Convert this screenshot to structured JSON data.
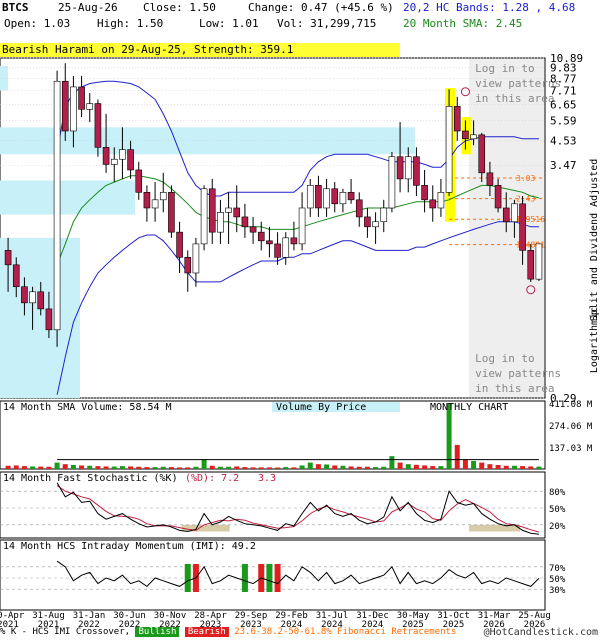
{
  "header": {
    "symbol": "BTCS",
    "date": "25-Aug-26",
    "close": "Close: 1.50",
    "change": "Change: 0.47 (+45.6 %)",
    "open": "Open: 1.03",
    "high": "High: 1.50",
    "low": "Low: 1.01",
    "vol": "Vol: 31,299,715",
    "bands": "20,2 HC Bands: 1.28 , 4.68",
    "sma": "20 Month SMA: 2.45"
  },
  "pattern_banner": "Bearish Harami on 29-Aug-25, Strength: 359.1",
  "login_text_1": [
    "Log in to",
    "view patterns",
    "in this area"
  ],
  "login_text_2": [
    "Log in to",
    "view patterns",
    "in this area"
  ],
  "right_axis_title": "Split and Dividend Adjusted",
  "log_label": "Logarithmic",
  "volume_label": "14 Month SMA Volume: 58.54 M",
  "vbp_label": "Volume By Price",
  "monthly_label": "MONTHLY CHART",
  "stoch_label": "14 Month Fast Stochastic (%K)",
  "stoch_d": "(%D): 7.2",
  "stoch_k": "3.3",
  "imi_label": "14 Month HCS Intraday Momentum (IMI): 49.2",
  "footer": {
    "prefix": "% K - HCS IMI Crossover,",
    "bullish": "Bullish",
    "bearish": "Bearish",
    "fib": "23.6-38.2-50-61.8% Fibonacci Retracements",
    "brand": "@HotCandlestick.com"
  },
  "colors": {
    "up": "#ffffff",
    "down": "#b0204a",
    "band": "#2020cc",
    "sma": "#1a8a1a",
    "vbp": "#c8f0f8",
    "fib": "#ff6a00",
    "highlight": "#ffff00",
    "grey": "#eeeeee"
  },
  "x_labels": [
    [
      "30-Apr",
      "2021"
    ],
    [
      "31-Aug",
      "2021"
    ],
    [
      "31-Jan",
      "2022"
    ],
    [
      "30-Jun",
      "2022"
    ],
    [
      "30-Nov",
      "2022"
    ],
    [
      "28-Apr",
      "2023"
    ],
    [
      "29-Sep",
      "2023"
    ],
    [
      "29-Feb",
      "2024"
    ],
    [
      "31-Jul",
      "2024"
    ],
    [
      "31-Dec",
      "2024"
    ],
    [
      "30-May",
      "2025"
    ],
    [
      "31-Oct",
      "2025"
    ],
    [
      "31-Mar",
      "2026"
    ],
    [
      "25-Aug",
      "2026"
    ]
  ],
  "chart_data": {
    "type": "line",
    "title": "BTCS Monthly Chart",
    "price_axis_scale": "log",
    "price_ticks": [
      10.89,
      9.83,
      8.77,
      7.71,
      6.65,
      5.59,
      4.53,
      3.47,
      0.29
    ],
    "fib_levels": [
      {
        "label": "3.03",
        "value": 3.03
      },
      {
        "label": "2.43",
        "value": 2.43
      },
      {
        "label": "1.9516",
        "value": 1.9516
      },
      {
        "label": "1.4881",
        "value": 1.4881
      }
    ],
    "candles": [
      [
        1.4,
        1.6,
        0.9,
        1.2
      ],
      [
        1.2,
        1.3,
        0.85,
        0.95
      ],
      [
        0.95,
        1.05,
        0.7,
        0.8
      ],
      [
        0.8,
        0.95,
        0.6,
        0.9
      ],
      [
        0.9,
        1.0,
        0.7,
        0.75
      ],
      [
        0.75,
        0.9,
        0.55,
        0.6
      ],
      [
        0.6,
        9.5,
        0.5,
        8.5
      ],
      [
        8.5,
        10.3,
        4.5,
        5.0
      ],
      [
        5.0,
        9.0,
        4.2,
        8.0
      ],
      [
        8.0,
        9.0,
        5.8,
        6.3
      ],
      [
        6.3,
        7.5,
        5.5,
        6.7
      ],
      [
        6.7,
        7.0,
        3.8,
        4.2
      ],
      [
        4.2,
        6.0,
        3.2,
        3.5
      ],
      [
        3.5,
        4.2,
        2.9,
        3.7
      ],
      [
        3.7,
        5.2,
        3.0,
        4.1
      ],
      [
        4.1,
        4.5,
        3.0,
        3.3
      ],
      [
        3.3,
        3.6,
        2.4,
        2.6
      ],
      [
        2.6,
        2.8,
        1.9,
        2.2
      ],
      [
        2.2,
        2.9,
        1.9,
        2.4
      ],
      [
        2.4,
        3.2,
        2.1,
        2.6
      ],
      [
        2.6,
        2.8,
        1.6,
        1.7
      ],
      [
        1.7,
        1.9,
        1.1,
        1.3
      ],
      [
        1.3,
        1.4,
        0.9,
        1.1
      ],
      [
        1.1,
        1.6,
        0.95,
        1.5
      ],
      [
        1.5,
        2.8,
        1.4,
        2.7
      ],
      [
        2.7,
        3.0,
        1.5,
        1.7
      ],
      [
        1.7,
        2.4,
        1.5,
        2.1
      ],
      [
        2.1,
        2.6,
        1.5,
        2.2
      ],
      [
        2.2,
        2.8,
        1.7,
        2.0
      ],
      [
        2.0,
        2.3,
        1.6,
        1.8
      ],
      [
        1.8,
        2.0,
        1.5,
        1.7
      ],
      [
        1.7,
        1.9,
        1.4,
        1.55
      ],
      [
        1.55,
        1.8,
        1.3,
        1.5
      ],
      [
        1.5,
        1.7,
        1.2,
        1.3
      ],
      [
        1.3,
        1.7,
        1.2,
        1.6
      ],
      [
        1.6,
        1.9,
        1.4,
        1.5
      ],
      [
        1.5,
        2.6,
        1.4,
        2.2
      ],
      [
        2.2,
        3.0,
        2.0,
        2.8
      ],
      [
        2.8,
        3.1,
        2.0,
        2.2
      ],
      [
        2.2,
        3.0,
        2.0,
        2.7
      ],
      [
        2.7,
        2.9,
        2.1,
        2.3
      ],
      [
        2.3,
        2.7,
        2.1,
        2.6
      ],
      [
        2.6,
        3.0,
        2.3,
        2.4
      ],
      [
        2.4,
        2.6,
        1.8,
        2.0
      ],
      [
        2.0,
        2.2,
        1.6,
        1.8
      ],
      [
        1.8,
        2.1,
        1.5,
        1.9
      ],
      [
        1.9,
        2.4,
        1.7,
        2.2
      ],
      [
        2.2,
        4.0,
        2.1,
        3.8
      ],
      [
        3.8,
        5.5,
        2.6,
        3.0
      ],
      [
        3.0,
        4.2,
        2.6,
        3.8
      ],
      [
        3.8,
        4.2,
        2.5,
        2.8
      ],
      [
        2.8,
        3.3,
        2.1,
        2.4
      ],
      [
        2.4,
        2.8,
        1.9,
        2.2
      ],
      [
        2.2,
        3.0,
        2.0,
        2.6
      ],
      [
        2.6,
        7.8,
        2.5,
        6.5
      ],
      [
        6.5,
        7.2,
        4.5,
        5.0
      ],
      [
        5.0,
        5.6,
        4.1,
        4.6
      ],
      [
        4.6,
        5.6,
        4.3,
        4.8
      ],
      [
        4.8,
        4.9,
        2.9,
        3.2
      ],
      [
        3.2,
        3.6,
        2.5,
        2.8
      ],
      [
        2.8,
        3.0,
        2.1,
        2.2
      ],
      [
        2.2,
        2.6,
        1.7,
        1.9
      ],
      [
        1.9,
        2.4,
        1.6,
        2.3
      ],
      [
        2.3,
        2.5,
        1.2,
        1.4
      ],
      [
        1.4,
        1.5,
        1.0,
        1.03
      ],
      [
        1.03,
        1.5,
        1.01,
        1.5
      ]
    ],
    "hc_band_upper": [
      null,
      null,
      null,
      null,
      null,
      null,
      4.0,
      6.5,
      7.5,
      8.0,
      8.3,
      8.4,
      8.5,
      8.5,
      8.4,
      8.3,
      8.0,
      7.5,
      7.0,
      6.0,
      5.0,
      4.0,
      3.2,
      2.8,
      2.6,
      2.5,
      2.5,
      2.6,
      2.6,
      2.6,
      2.6,
      2.6,
      2.6,
      2.6,
      2.6,
      2.6,
      2.8,
      3.3,
      3.6,
      3.8,
      3.9,
      3.9,
      3.9,
      3.9,
      3.9,
      3.8,
      3.7,
      3.6,
      3.6,
      3.6,
      3.6,
      3.5,
      3.4,
      3.4,
      3.7,
      4.2,
      4.5,
      4.6,
      4.7,
      4.7,
      4.7,
      4.7,
      4.7,
      4.6,
      4.6,
      4.6
    ],
    "hc_band_lower": [
      null,
      null,
      null,
      null,
      null,
      null,
      0.3,
      0.45,
      0.65,
      0.8,
      0.95,
      1.1,
      1.2,
      1.3,
      1.4,
      1.5,
      1.6,
      1.65,
      1.65,
      1.55,
      1.4,
      1.25,
      1.1,
      1.0,
      1.0,
      1.0,
      1.0,
      1.05,
      1.1,
      1.15,
      1.2,
      1.25,
      1.25,
      1.25,
      1.3,
      1.3,
      1.35,
      1.35,
      1.4,
      1.45,
      1.5,
      1.55,
      1.55,
      1.5,
      1.45,
      1.4,
      1.4,
      1.4,
      1.4,
      1.4,
      1.45,
      1.45,
      1.5,
      1.55,
      1.6,
      1.65,
      1.7,
      1.75,
      1.8,
      1.85,
      1.9,
      1.9,
      1.9,
      1.85,
      1.8,
      1.8
    ],
    "sma_20": [
      null,
      null,
      null,
      null,
      null,
      null,
      1.2,
      1.5,
      1.9,
      2.2,
      2.4,
      2.6,
      2.8,
      2.9,
      3.0,
      3.1,
      3.1,
      3.05,
      3.0,
      2.9,
      2.7,
      2.5,
      2.3,
      2.1,
      2.0,
      1.95,
      1.9,
      1.9,
      1.85,
      1.8,
      1.8,
      1.8,
      1.75,
      1.75,
      1.75,
      1.75,
      1.8,
      1.85,
      1.9,
      1.95,
      2.0,
      2.05,
      2.1,
      2.15,
      2.2,
      2.2,
      2.2,
      2.2,
      2.25,
      2.3,
      2.35,
      2.35,
      2.35,
      2.35,
      2.4,
      2.5,
      2.6,
      2.7,
      2.8,
      2.8,
      2.75,
      2.7,
      2.65,
      2.6,
      2.5,
      2.45
    ],
    "volume_ticks": [
      411.08,
      274.06,
      137.03
    ],
    "volume": [
      20,
      22,
      18,
      16,
      15,
      14,
      40,
      30,
      25,
      22,
      20,
      18,
      16,
      15,
      18,
      16,
      14,
      12,
      12,
      14,
      12,
      10,
      10,
      14,
      60,
      20,
      14,
      14,
      16,
      12,
      10,
      10,
      10,
      9,
      12,
      10,
      22,
      40,
      30,
      28,
      22,
      20,
      16,
      14,
      14,
      12,
      14,
      80,
      40,
      30,
      26,
      22,
      18,
      18,
      411,
      150,
      60,
      50,
      40,
      30,
      25,
      20,
      20,
      18,
      16,
      15
    ],
    "stoch_ticks": [
      "80%",
      "50%",
      "20%"
    ],
    "stoch_k": [
      null,
      null,
      null,
      null,
      null,
      null,
      95,
      70,
      78,
      60,
      62,
      40,
      30,
      35,
      40,
      30,
      22,
      16,
      18,
      20,
      16,
      10,
      8,
      12,
      40,
      20,
      25,
      35,
      28,
      22,
      20,
      18,
      14,
      10,
      22,
      18,
      40,
      60,
      45,
      55,
      40,
      35,
      40,
      28,
      22,
      25,
      34,
      70,
      45,
      60,
      40,
      28,
      24,
      30,
      80,
      60,
      55,
      58,
      40,
      30,
      22,
      18,
      20,
      10,
      5,
      3.3
    ],
    "stoch_d": [
      null,
      null,
      null,
      null,
      null,
      null,
      90,
      80,
      75,
      70,
      66,
      55,
      44,
      36,
      35,
      34,
      30,
      22,
      18,
      18,
      18,
      15,
      12,
      10,
      20,
      24,
      28,
      27,
      30,
      28,
      23,
      20,
      17,
      14,
      15,
      17,
      27,
      40,
      48,
      53,
      47,
      43,
      38,
      34,
      30,
      25,
      27,
      43,
      50,
      58,
      48,
      43,
      31,
      28,
      45,
      57,
      65,
      58,
      51,
      43,
      30,
      22,
      20,
      16,
      11,
      7.2
    ],
    "imi_ticks": [
      "70%",
      "50%",
      "30%"
    ],
    "imi": [
      null,
      null,
      null,
      null,
      null,
      null,
      80,
      70,
      45,
      55,
      60,
      40,
      50,
      45,
      55,
      40,
      45,
      35,
      50,
      45,
      40,
      35,
      45,
      50,
      70,
      40,
      45,
      55,
      50,
      45,
      40,
      50,
      45,
      40,
      55,
      45,
      70,
      60,
      45,
      60,
      40,
      45,
      55,
      40,
      45,
      50,
      55,
      70,
      40,
      60,
      40,
      45,
      40,
      50,
      65,
      55,
      50,
      60,
      40,
      45,
      40,
      50,
      45,
      40,
      35,
      49.2
    ]
  }
}
